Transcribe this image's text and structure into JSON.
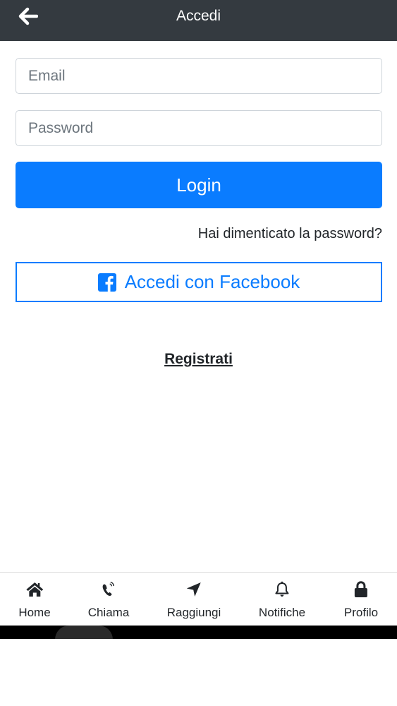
{
  "header": {
    "back_icon": "arrow-left-icon",
    "title": "Accedi"
  },
  "form": {
    "email_placeholder": "Email",
    "email_value": "",
    "password_placeholder": "Password",
    "password_value": "",
    "login_label": "Login",
    "forgot_label": "Hai dimenticato la password?",
    "facebook_label": "Accedi con Facebook",
    "facebook_icon": "facebook-square-icon",
    "register_label": "Registrati"
  },
  "tabbar": {
    "items": [
      {
        "label": "Home",
        "icon": "home-icon"
      },
      {
        "label": "Chiama",
        "icon": "phone-icon"
      },
      {
        "label": "Raggiungi",
        "icon": "location-arrow-icon"
      },
      {
        "label": "Notifiche",
        "icon": "bell-icon"
      },
      {
        "label": "Profilo",
        "icon": "lock-icon"
      }
    ]
  },
  "colors": {
    "header_bg": "#343a40",
    "primary": "#0a7cff",
    "text": "#212529"
  }
}
